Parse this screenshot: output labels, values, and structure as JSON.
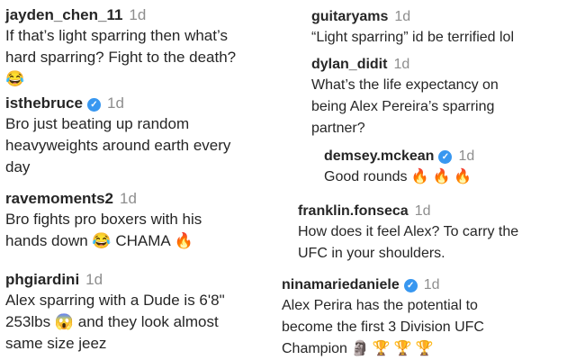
{
  "left": [
    {
      "user": "jayden_chen_11",
      "time": "1d",
      "verified": false,
      "lines": [
        "If that’s light sparring then what’s",
        "hard sparring? Fight to the death?"
      ],
      "emojis": [
        "😂"
      ]
    },
    {
      "user": "isthebruce",
      "time": "1d",
      "verified": true,
      "lines": [
        "Bro just beating up random",
        "heavyweights around earth every",
        "day"
      ],
      "emojis": []
    },
    {
      "user": "ravemoments2",
      "time": "1d",
      "verified": false,
      "lines": [
        "Bro fights pro boxers with his",
        "hands down"
      ],
      "emojis": [
        "😂"
      ],
      "after_emoji_text": "CHAMA",
      "trailing_emojis": [
        "🔥"
      ]
    },
    {
      "user": "phgiardini",
      "time": "1d",
      "verified": false,
      "lines": [
        "Alex sparring with a Dude is 6'8\"",
        "253lbs",
        "same size jeez"
      ],
      "emojis": [
        "😱"
      ],
      "after_emoji_text": "and they look almost"
    }
  ],
  "right": [
    {
      "user": "guitaryams",
      "time": "1d",
      "verified": false,
      "lines": [
        "“Light sparring” id be terrified lol"
      ]
    },
    {
      "user": "dylan_didit",
      "time": "1d",
      "verified": false,
      "lines": [
        "What’s the life expectancy on",
        "being Alex Pereira’s sparring",
        "partner?"
      ]
    },
    {
      "user": "demsey.mckean",
      "time": "1d",
      "verified": true,
      "lines": [
        "Good rounds"
      ],
      "emojis": [
        "🔥",
        "🔥",
        "🔥"
      ]
    },
    {
      "user": "franklin.fonseca",
      "time": "1d",
      "verified": false,
      "lines": [
        "How does it feel Alex? To carry the",
        "UFC in your shoulders."
      ]
    },
    {
      "user": "ninamariedaniele",
      "time": "1d",
      "verified": true,
      "lines": [
        "Alex Perira has the potential to",
        "become the first 3 Division UFC",
        "Champion"
      ],
      "emojis": [
        "🗿",
        "🏆",
        "🏆",
        "🏆"
      ]
    }
  ],
  "badge_symbol": "✓",
  "colors": {
    "username": "#262626",
    "timestamp": "#8e8e8e",
    "verified": "#3897f0"
  }
}
